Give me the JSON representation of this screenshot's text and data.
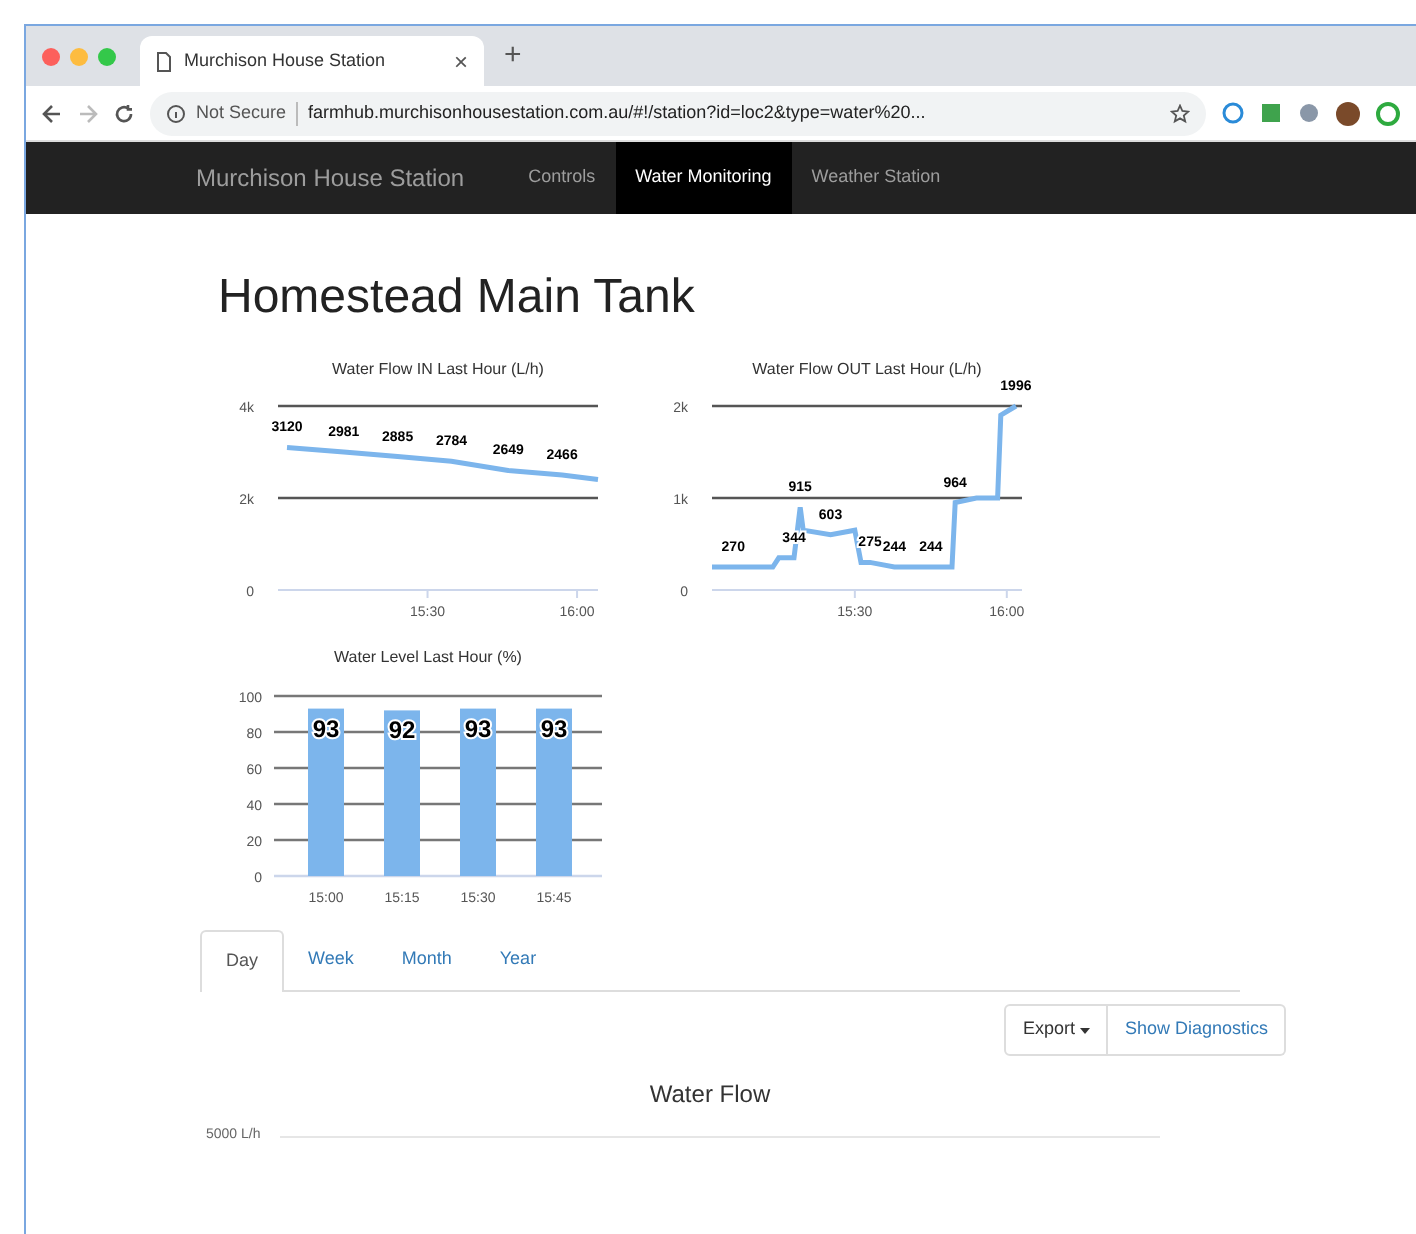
{
  "browser": {
    "tab_title": "Murchison House Station",
    "close_tab": "×",
    "new_tab": "+",
    "security": "Not Secure",
    "url": "farmhub.murchisonhousestation.com.au/#!/station?id=loc2&type=water%20..."
  },
  "navbar": {
    "brand": "Murchison House Station",
    "links": [
      {
        "label": "Controls",
        "selected": false
      },
      {
        "label": "Water Monitoring",
        "selected": true
      },
      {
        "label": "Weather Station",
        "selected": false
      }
    ]
  },
  "heading": "Homestead Main Tank",
  "flow_in": {
    "chart_data": {
      "type": "line",
      "title": "Water Flow IN Last Hour (L/h)",
      "grid": true,
      "x": [
        15.03,
        15.22,
        15.4,
        15.58,
        15.77,
        15.95,
        16.07
      ],
      "series": [
        {
          "color": "#7cb5ec",
          "values": [
            3100,
            3000,
            2900,
            2800,
            2600,
            2500,
            2400
          ]
        }
      ],
      "value_labels": [
        "3120",
        "2981",
        "2885",
        "2784",
        "2649",
        "2466",
        null
      ],
      "xlim": [
        15,
        16.07
      ],
      "ylim": [
        0,
        4000
      ],
      "xticks": [
        {
          "value": 15.5,
          "label": "15:30"
        },
        {
          "value": 16,
          "label": "16:00"
        }
      ],
      "yticks": [
        {
          "value": 0,
          "label": "0"
        },
        {
          "value": 2000,
          "label": "2k"
        },
        {
          "value": 4000,
          "label": "4k"
        }
      ]
    }
  },
  "flow_out": {
    "chart_data": {
      "type": "line",
      "title": "Water Flow OUT Last Hour (L/h)",
      "grid": true,
      "x": [
        15.03,
        15.1,
        15.23,
        15.25,
        15.3,
        15.32,
        15.33,
        15.42,
        15.5,
        15.52,
        15.55,
        15.63,
        15.75,
        15.82,
        15.83,
        15.9,
        15.97,
        15.98,
        16.03
      ],
      "series": [
        {
          "color": "#7cb5ec",
          "values": [
            250,
            250,
            250,
            350,
            350,
            900,
            650,
            600,
            650,
            300,
            300,
            250,
            250,
            250,
            950,
            1000,
            1000,
            1900,
            2000
          ]
        }
      ],
      "value_labels": [
        null,
        "270",
        null,
        null,
        "344",
        "915",
        null,
        "603",
        null,
        null,
        "275",
        "244",
        "244",
        null,
        "964",
        null,
        null,
        null,
        "1996"
      ],
      "xlim": [
        15.03,
        16.05
      ],
      "ylim": [
        0,
        2000
      ],
      "xticks": [
        {
          "value": 15.5,
          "label": "15:30"
        },
        {
          "value": 16,
          "label": "16:00"
        }
      ],
      "yticks": [
        {
          "value": 0,
          "label": "0"
        },
        {
          "value": 1000,
          "label": "1k"
        },
        {
          "value": 2000,
          "label": "2k"
        }
      ]
    }
  },
  "level": {
    "chart_data": {
      "type": "bar",
      "title": "Water Level Last Hour (%)",
      "grid": true,
      "categories": [
        "15:00",
        "15:15",
        "15:30",
        "15:45"
      ],
      "series": [
        {
          "color": "#7cb5ec",
          "values": [
            93,
            92,
            93,
            93
          ]
        }
      ],
      "data_labels": true,
      "ylim": [
        0,
        100
      ],
      "yticks": [
        0,
        20,
        40,
        60,
        80,
        100
      ]
    }
  },
  "period_tabs": [
    {
      "label": "Day",
      "selected": true
    },
    {
      "label": "Week",
      "selected": false
    },
    {
      "label": "Month",
      "selected": false
    },
    {
      "label": "Year",
      "selected": false
    }
  ],
  "buttons": {
    "export": "Export",
    "diagnostics": "Show Diagnostics"
  },
  "water_flow": {
    "title": "Water Flow",
    "axis_label": "5000 L/h"
  }
}
